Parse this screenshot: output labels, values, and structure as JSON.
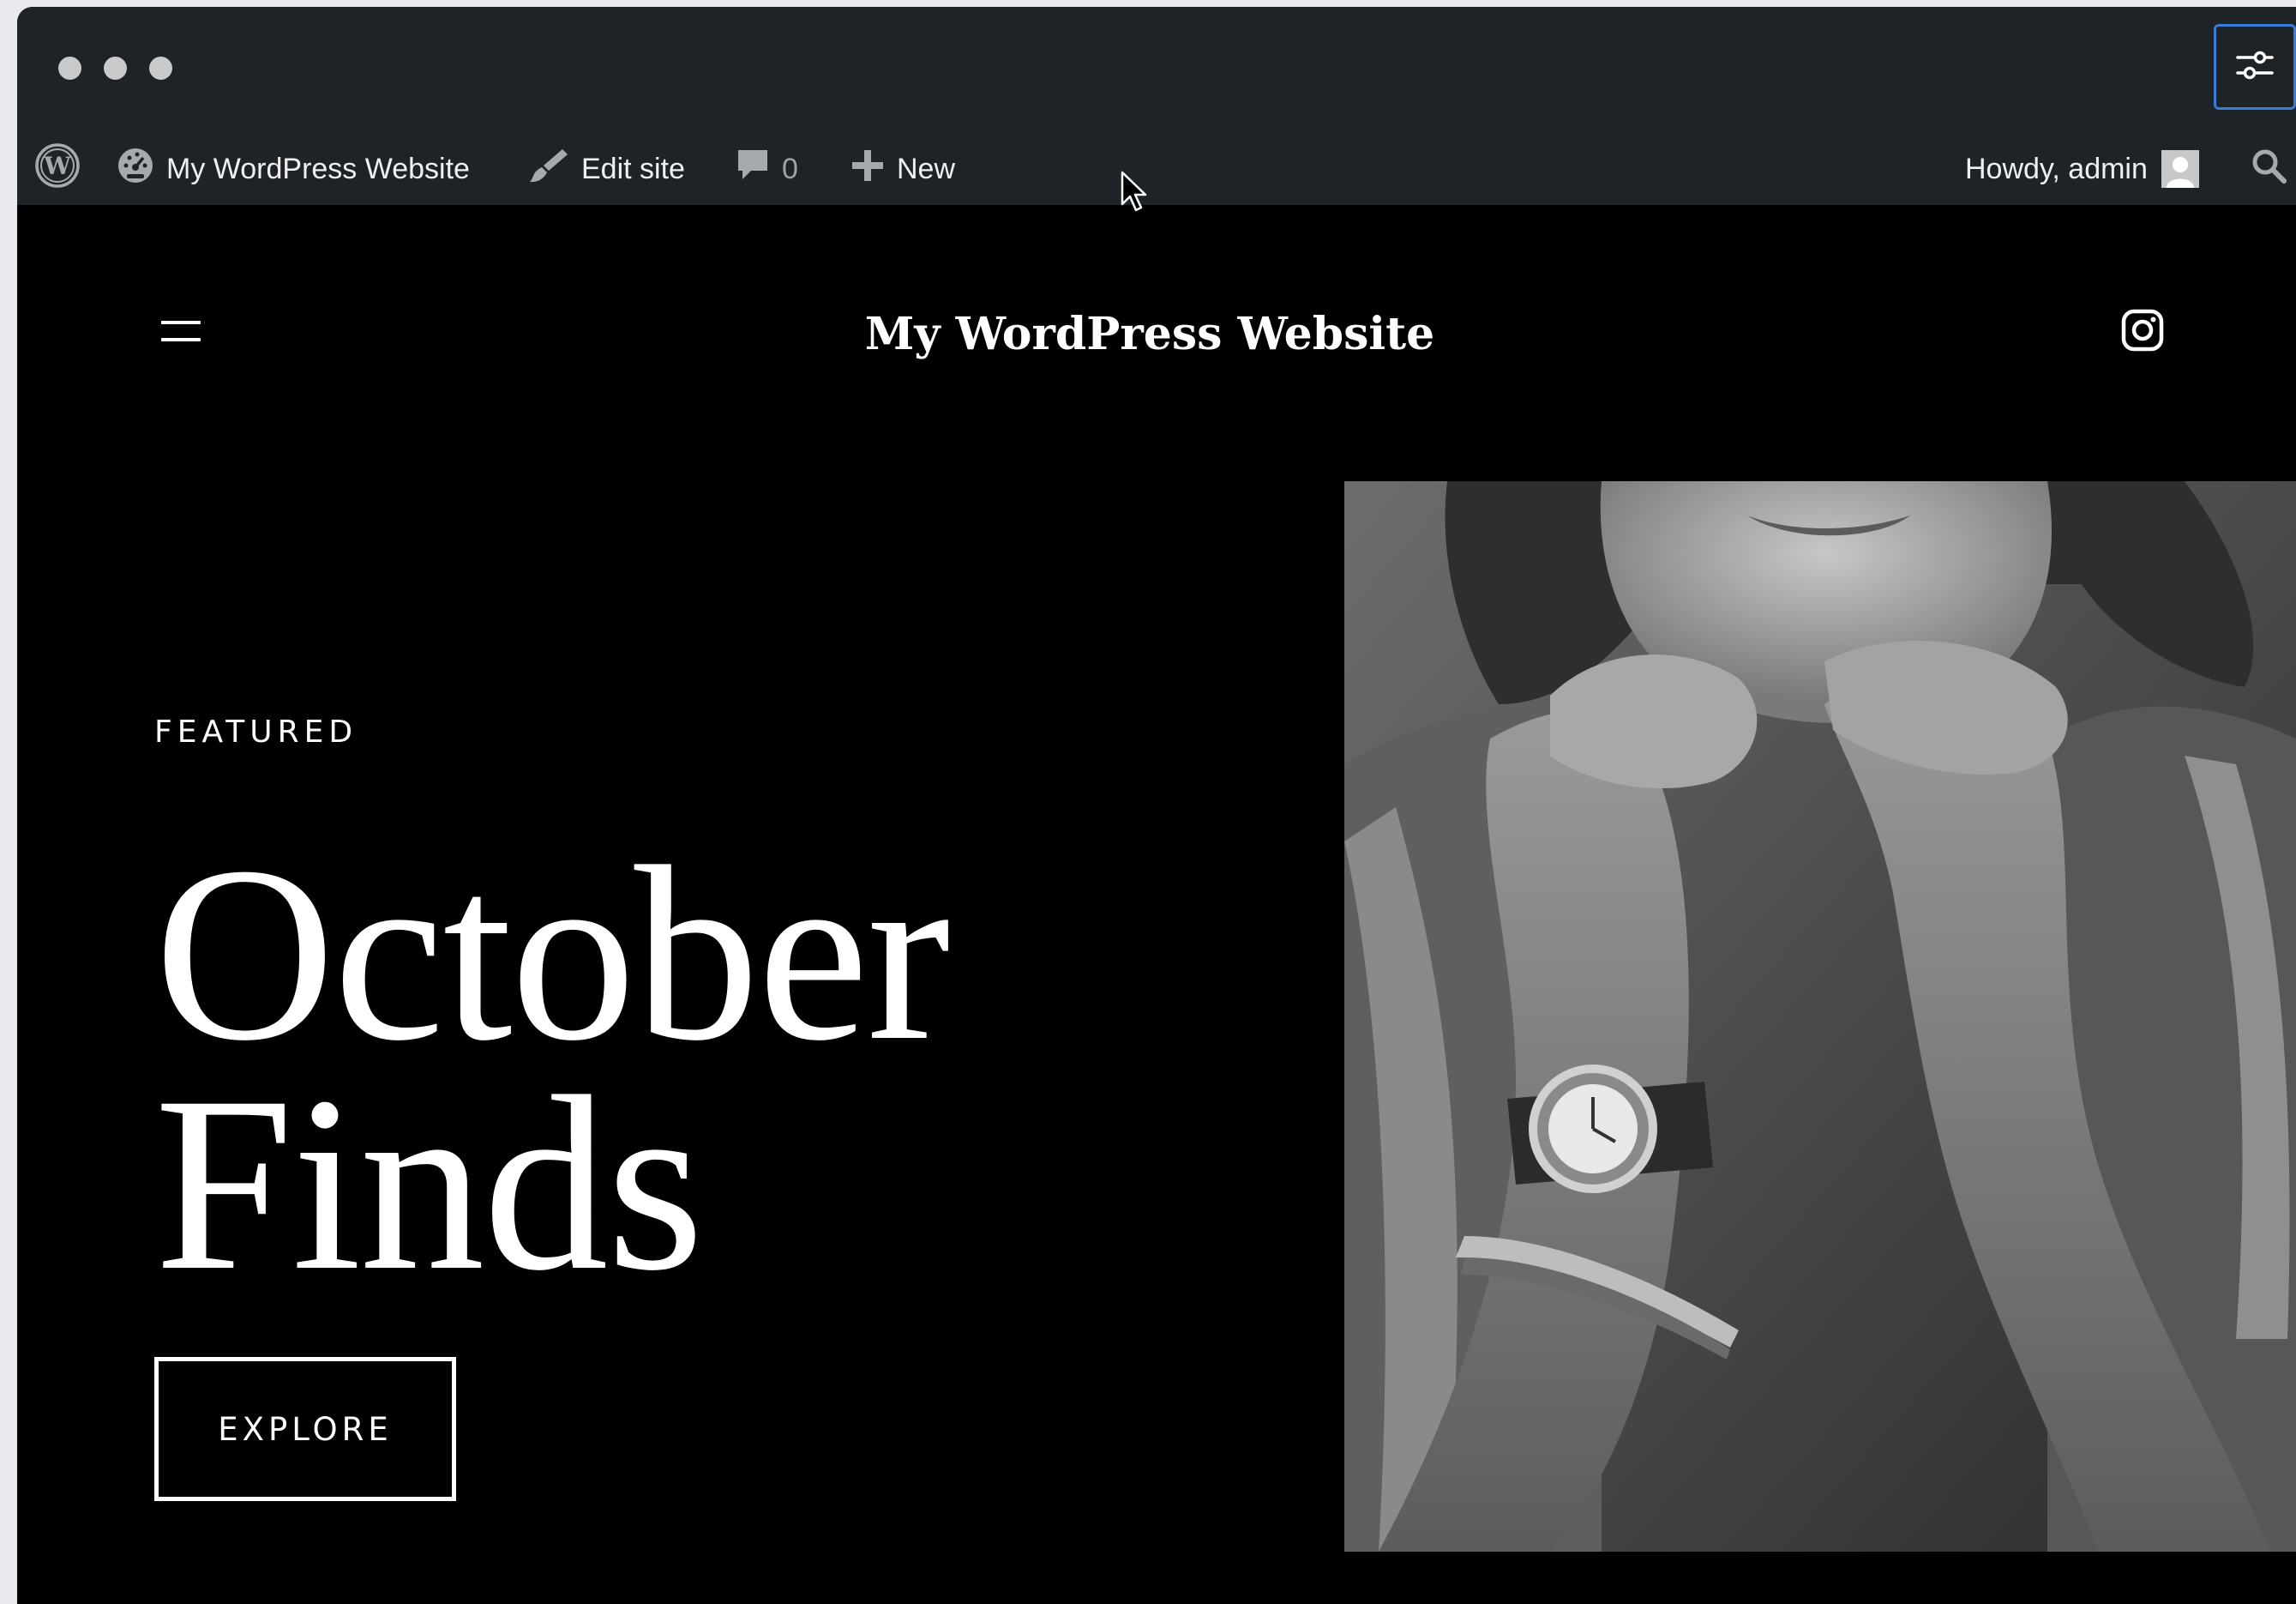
{
  "window": {
    "traffic_lights": [
      "close",
      "minimize",
      "zoom"
    ],
    "settings_icon": "sliders-icon"
  },
  "admin_bar": {
    "wp_logo_icon": "wordpress-logo-icon",
    "site_name": "My WordPress Website",
    "edit_site": "Edit site",
    "comments_count": "0",
    "new_label": "New",
    "greeting": "Howdy, admin",
    "search_icon": "search-icon"
  },
  "site": {
    "title": "My WordPress Website",
    "menu_icon": "hamburger-menu-icon",
    "social_icon": "instagram-icon",
    "hero": {
      "eyebrow": "FEATURED",
      "headline_line1": "October",
      "headline_line2": "Finds",
      "cta_label": "EXPLORE"
    }
  },
  "colors": {
    "admin_bar_bg": "#1d2327",
    "site_bg": "#000000",
    "text": "#ffffff",
    "focus_ring": "#3a7bd5"
  }
}
